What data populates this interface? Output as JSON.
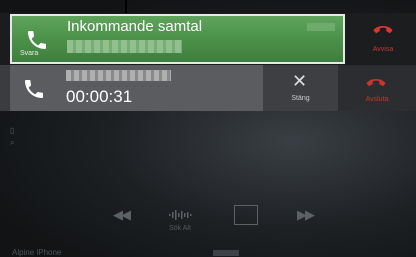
{
  "incoming_call": {
    "title": "Inkommande samtal",
    "answer_label": "Svara",
    "reject_label": "Avvisa"
  },
  "active_call": {
    "timer": "00:00:31",
    "close_label": "Stäng",
    "end_label": "Avsluta"
  },
  "controls": {
    "search_label": "Sök Alt"
  },
  "status": {
    "device_name": "Alpine iPhone"
  },
  "colors": {
    "answer_green": "#4a8f48",
    "reject_red": "#d43a34"
  }
}
